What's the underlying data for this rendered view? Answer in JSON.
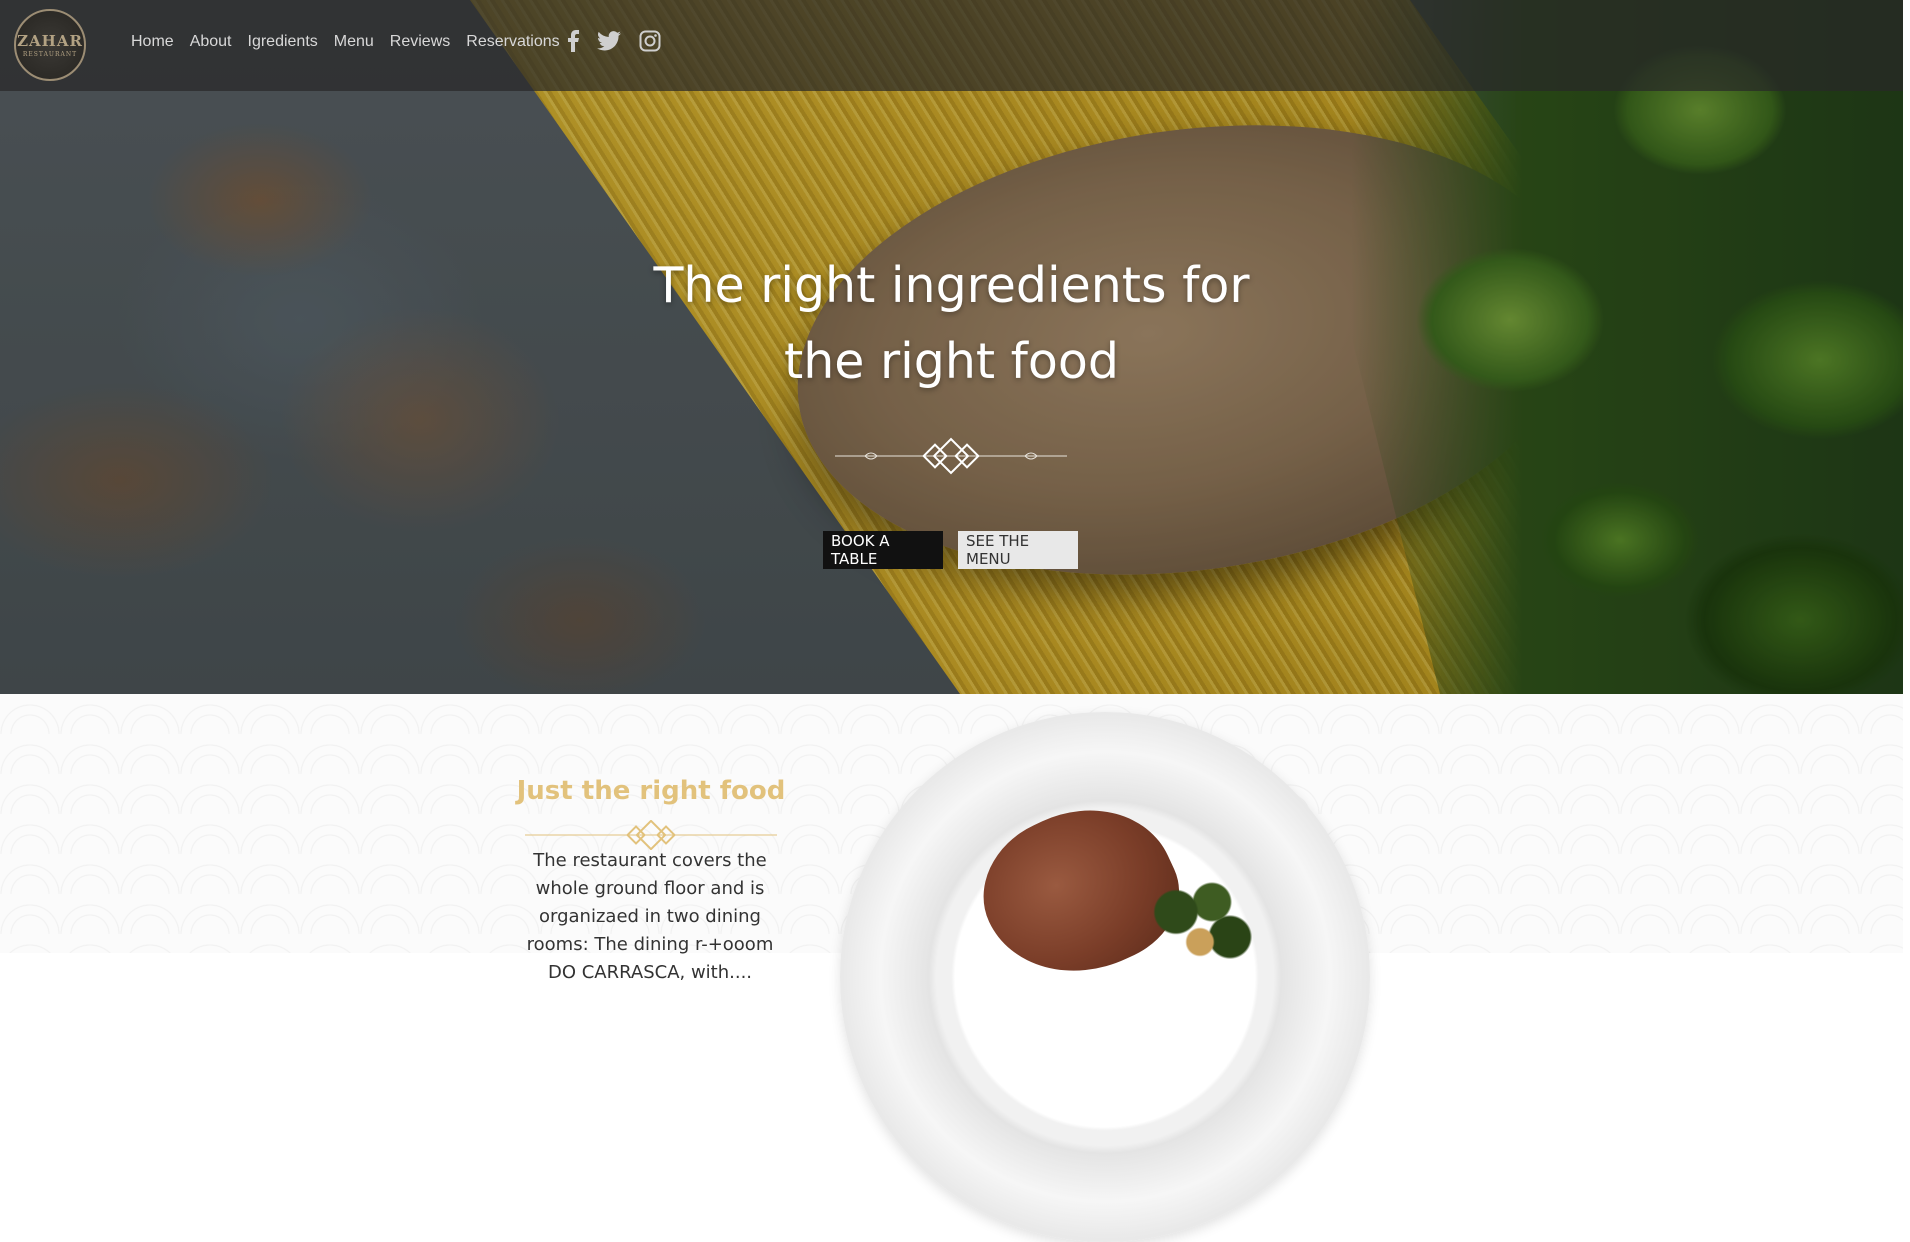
{
  "brand": {
    "logo_text": "ZAHAR",
    "logo_subtext": "RESTAURANT"
  },
  "nav": {
    "links": [
      "Home",
      "About",
      "Igredients",
      "Menu",
      "Reviews",
      "Reservations"
    ],
    "social_icons": [
      "facebook-icon",
      "twitter-icon",
      "instagram-icon"
    ]
  },
  "hero": {
    "title_line1": "The right ingredients for",
    "title_line2": "the right food",
    "book_button": "BOOK A TABLE",
    "menu_button": "SEE THE MENU"
  },
  "about": {
    "heading": "Just the right food",
    "text": "The restaurant covers the whole ground floor and is organizaed in two dining rooms: The dining r-+ooom DO CARRASCA, with...."
  },
  "colors": {
    "accent_gold": "#e2c27c",
    "nav_bg": "rgba(40,40,40,0.72)",
    "book_button_bg": "#111111",
    "menu_button_bg": "#e8e8e8"
  }
}
